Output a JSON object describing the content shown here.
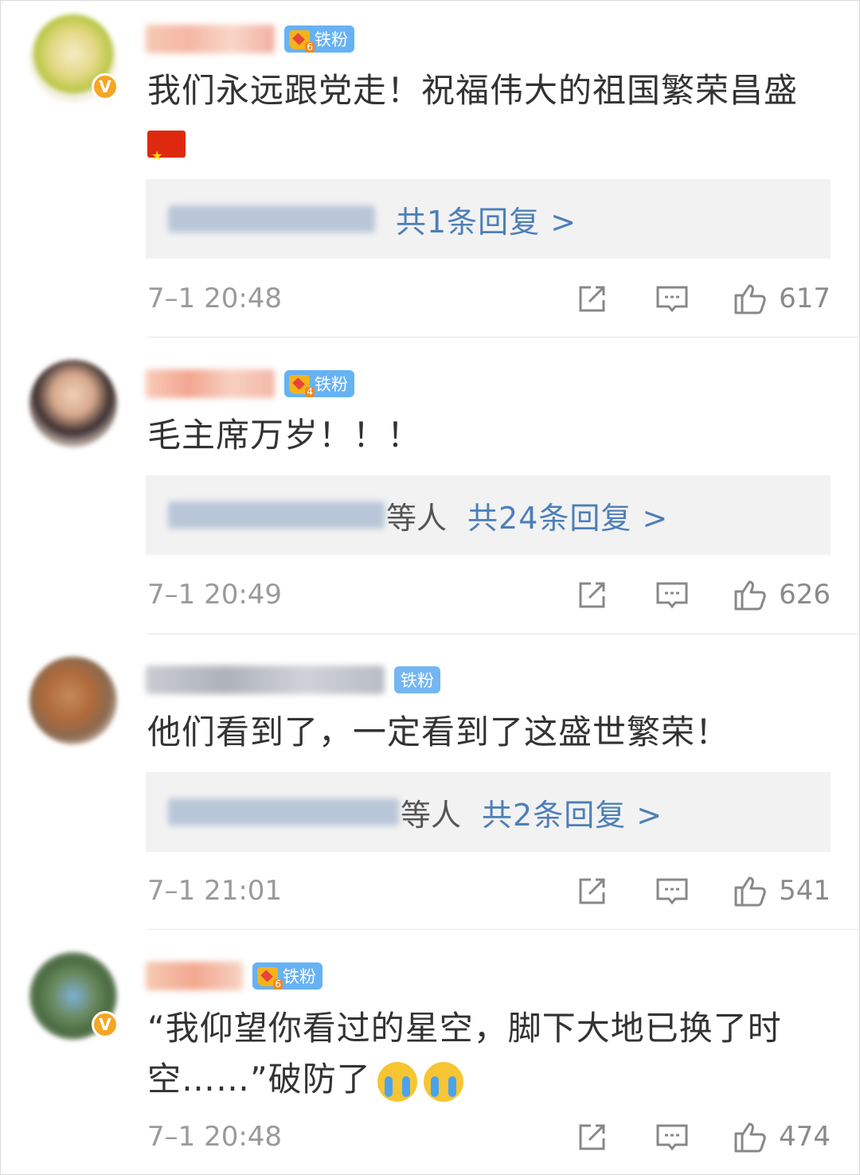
{
  "comments": [
    {
      "avatar_color": "#e8d36a",
      "verified": true,
      "badge_level": "6",
      "badge_label": "铁粉",
      "text": "我们永远跟党走！祝福伟大的祖国繁荣昌盛",
      "reply_suffix": "",
      "reply_link": "共1条回复 >",
      "time": "7–1 20:48",
      "likes": "617"
    },
    {
      "avatar_color": "#9a7d6a",
      "verified": false,
      "badge_level": "4",
      "badge_label": "铁粉",
      "text": "毛主席万岁！！！",
      "reply_suffix": "等人",
      "reply_link": "共24条回复 >",
      "time": "7–1 20:49",
      "likes": "626"
    },
    {
      "avatar_color": "#b06a3a",
      "verified": false,
      "badge_level": "",
      "badge_label": "铁粉",
      "text": "他们看到了，一定看到了这盛世繁荣！",
      "reply_suffix": "等人",
      "reply_link": "共2条回复 >",
      "time": "7–1 21:01",
      "likes": "541"
    },
    {
      "avatar_color": "#5a7a50",
      "verified": true,
      "badge_level": "6",
      "badge_label": "铁粉",
      "text_line1": "“我仰望你看过的星空，脚下大地已换了时",
      "text_line2": "空……”破防了",
      "time": "7–1 20:48",
      "likes": "474"
    }
  ],
  "icons": {
    "share": "share-icon",
    "comment": "comment-icon",
    "like": "like-icon",
    "verified": "verified-v-icon",
    "flag": "china-flag-emoji",
    "cry": "crying-face-emoji"
  },
  "colors": {
    "link": "#4d7fb8",
    "badge": "#66b2f5",
    "verified": "#f5a623"
  }
}
